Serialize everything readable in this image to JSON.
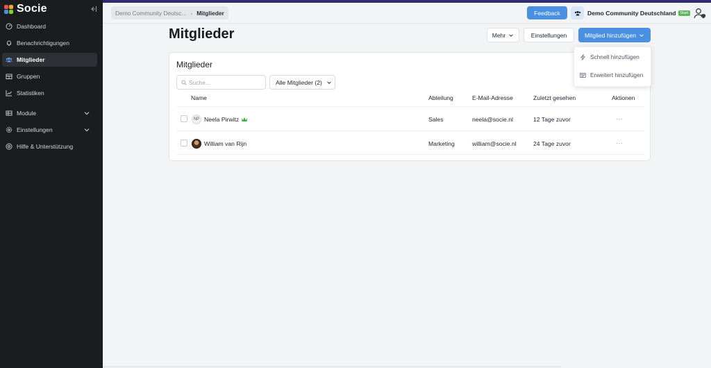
{
  "app": {
    "name": "Socie"
  },
  "colors": {
    "accent": "#4a90e2",
    "sidebar_bg": "#1b1c20",
    "badge_green": "#5cb85c",
    "crown_green": "#3cb043"
  },
  "sidebar": {
    "items": [
      {
        "label": "Dashboard",
        "icon": "dashboard-icon"
      },
      {
        "label": "Benachrichtigungen",
        "icon": "bell-icon"
      },
      {
        "label": "Mitglieder",
        "icon": "users-icon",
        "active": true
      },
      {
        "label": "Gruppen",
        "icon": "groups-icon"
      },
      {
        "label": "Statistiken",
        "icon": "chart-icon"
      },
      {
        "label": "Module",
        "icon": "module-icon",
        "expandable": true
      },
      {
        "label": "Einstellungen",
        "icon": "gear-icon",
        "expandable": true
      },
      {
        "label": "Hilfe & Unterstützung",
        "icon": "help-icon"
      }
    ]
  },
  "topbar": {
    "breadcrumb": [
      "Demo Community Deutsc...",
      "Mitglieder"
    ],
    "feedback_label": "Feedback",
    "community_name": "Demo Community Deutschland",
    "plan_badge": "Start"
  },
  "page": {
    "title": "Mitglieder",
    "more_label": "Mehr",
    "settings_label": "Einstellungen",
    "add_member_label": "Mitglied hinzufügen"
  },
  "add_menu": {
    "items": [
      {
        "label": "Schnell hinzufügen",
        "icon": "lightning-icon"
      },
      {
        "label": "Erweitert hinzufügen",
        "icon": "form-icon"
      }
    ]
  },
  "members": {
    "card_title": "Mitglieder",
    "search_placeholder": "Suche...",
    "filter_label": "Alle Mitglieder (2)",
    "columns": [
      "Name",
      "Abteilung",
      "E-Mail-Adresse",
      "Zuletzt gesehen",
      "Aktionen"
    ],
    "rows": [
      {
        "initials": "NP",
        "name": "Neela Pirwitz",
        "admin": true,
        "department": "Sales",
        "email": "neela@socie.nl",
        "last_seen": "12 Tage zuvor",
        "actions": "···"
      },
      {
        "initials": "",
        "name": "William van Rijn",
        "admin": false,
        "department": "Marketing",
        "email": "william@socie.nl",
        "last_seen": "24 Tage zuvor",
        "actions": "···"
      }
    ]
  }
}
